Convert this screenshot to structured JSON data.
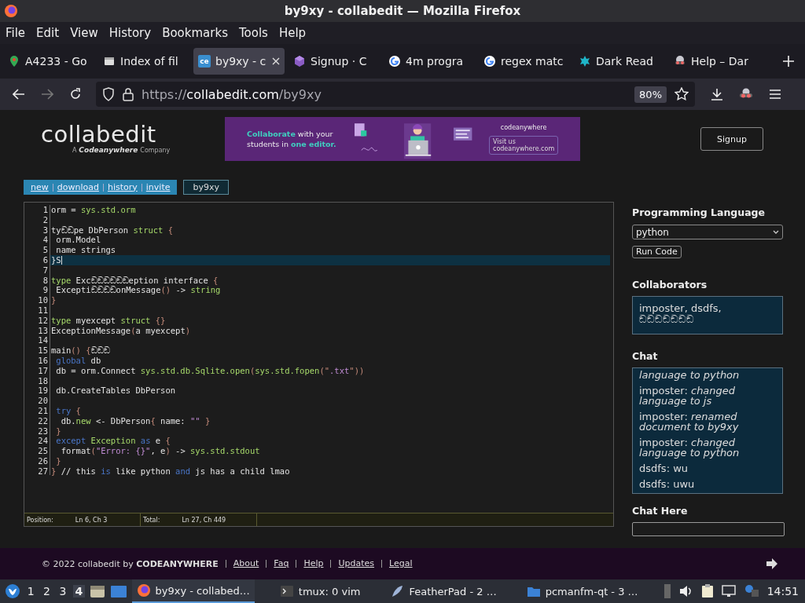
{
  "window": {
    "title": "by9xy - collabedit — Mozilla Firefox"
  },
  "menu": [
    "File",
    "Edit",
    "View",
    "History",
    "Bookmarks",
    "Tools",
    "Help"
  ],
  "tabs": [
    {
      "label": "A4233 - Go",
      "selected": false
    },
    {
      "label": "Index of fil",
      "selected": false
    },
    {
      "label": "by9xy - c",
      "icon_text": "ce",
      "selected": true
    },
    {
      "label": "Signup · C",
      "selected": false
    },
    {
      "label": "4m progra",
      "selected": false
    },
    {
      "label": "regex matc",
      "selected": false
    },
    {
      "label": "Dark Read",
      "selected": false
    },
    {
      "label": "Help – Dar",
      "selected": false
    }
  ],
  "address": {
    "prefix": "https://",
    "host": "collabedit.com",
    "path": "/by9xy",
    "zoom": "80%"
  },
  "site": {
    "logo": "collabedit",
    "logo_sub_prefix": "A",
    "logo_sub_brand": "Codeanywhere",
    "logo_sub_suffix": "Company",
    "ad": {
      "line1_accent": "Collaborate",
      "line1": "with your",
      "line2": "students in",
      "line2_accent": "one editor.",
      "brand": "codeanywhere",
      "visit": "Visit us",
      "url": "codeanywhere.com"
    },
    "signup": "Signup",
    "links": [
      "new",
      "download",
      "history",
      "invite"
    ],
    "document_name": "by9xy"
  },
  "editor": {
    "lines": [
      {
        "n": "1",
        "current": false,
        "tokens": [
          {
            "text": "orm = ",
            "kind": "plain"
          },
          {
            "text": "sys.std.orm",
            "kind": "builtin"
          }
        ]
      },
      {
        "n": "2",
        "current": false
      },
      {
        "n": "3",
        "current": false,
        "tokens": [
          {
            "text": "tyඞඞpe DbPerson ",
            "kind": "plain"
          },
          {
            "text": "struct",
            "kind": "builtin"
          },
          {
            "text": " {",
            "kind": "bracket"
          }
        ]
      },
      {
        "n": "4",
        "current": false,
        "tokens": [
          {
            "text": " orm.Model",
            "kind": "plain"
          }
        ]
      },
      {
        "n": "5",
        "current": false,
        "tokens": [
          {
            "text": " name strings",
            "kind": "plain"
          }
        ]
      },
      {
        "n": "6",
        "current": true,
        "tokens": [
          {
            "text": "}S",
            "kind": "plain"
          }
        ]
      },
      {
        "n": "7",
        "current": false
      },
      {
        "n": "8",
        "current": false,
        "tokens": [
          {
            "text": "type",
            "kind": "builtin"
          },
          {
            "text": " Excඞඞඞඞඞඞeption interface ",
            "kind": "plain"
          },
          {
            "text": "{",
            "kind": "bracket"
          }
        ]
      },
      {
        "n": "9",
        "current": false,
        "tokens": [
          {
            "text": " ExceptiඞඞඞඞonMessage",
            "kind": "plain"
          },
          {
            "text": "()",
            "kind": "bracket"
          },
          {
            "text": " -> ",
            "kind": "plain"
          },
          {
            "text": "string",
            "kind": "builtin"
          }
        ]
      },
      {
        "n": "10",
        "current": false,
        "tokens": [
          {
            "text": "}",
            "kind": "bracket"
          }
        ]
      },
      {
        "n": "11",
        "current": false
      },
      {
        "n": "12",
        "current": false,
        "tokens": [
          {
            "text": "type",
            "kind": "builtin"
          },
          {
            "text": " myexcept ",
            "kind": "plain"
          },
          {
            "text": "struct",
            "kind": "builtin"
          },
          {
            "text": " {}",
            "kind": "bracket"
          }
        ]
      },
      {
        "n": "13",
        "current": false,
        "tokens": [
          {
            "text": "ExceptionMessage",
            "kind": "plain"
          },
          {
            "text": "(",
            "kind": "bracket"
          },
          {
            "text": "a myexcept",
            "kind": "plain"
          },
          {
            "text": ")",
            "kind": "bracket"
          }
        ]
      },
      {
        "n": "14",
        "current": false
      },
      {
        "n": "15",
        "current": false,
        "tokens": [
          {
            "text": "main",
            "kind": "plain"
          },
          {
            "text": "() {",
            "kind": "bracket"
          },
          {
            "text": "ඞඞඞ",
            "kind": "plain"
          }
        ]
      },
      {
        "n": "16",
        "current": false,
        "tokens": [
          {
            "text": " global",
            "kind": "keyword"
          },
          {
            "text": " db",
            "kind": "plain"
          }
        ]
      },
      {
        "n": "17",
        "current": false,
        "tokens": [
          {
            "text": " db = orm.Connect ",
            "kind": "plain"
          },
          {
            "text": "sys.std.db.Sqlite.open",
            "kind": "builtin"
          },
          {
            "text": "(",
            "kind": "bracket"
          },
          {
            "text": "sys.std.fopen",
            "kind": "builtin"
          },
          {
            "text": "(\"",
            "kind": "bracket"
          },
          {
            "text": ".txt",
            "kind": "string"
          },
          {
            "text": "\"))",
            "kind": "bracket"
          }
        ]
      },
      {
        "n": "18",
        "current": false
      },
      {
        "n": "19",
        "current": false,
        "tokens": [
          {
            "text": " db.CreateTables DbPerson",
            "kind": "plain"
          }
        ]
      },
      {
        "n": "20",
        "current": false
      },
      {
        "n": "21",
        "current": false,
        "tokens": [
          {
            "text": " try",
            "kind": "keyword"
          },
          {
            "text": " {",
            "kind": "bracket"
          }
        ]
      },
      {
        "n": "22",
        "current": false,
        "tokens": [
          {
            "text": "  db.",
            "kind": "plain"
          },
          {
            "text": "new",
            "kind": "builtin"
          },
          {
            "text": " <- DbPerson",
            "kind": "plain"
          },
          {
            "text": "{",
            "kind": "bracket"
          },
          {
            "text": " name: ",
            "kind": "plain"
          },
          {
            "text": "\"\"",
            "kind": "string"
          },
          {
            "text": " }",
            "kind": "bracket"
          }
        ]
      },
      {
        "n": "23",
        "current": false,
        "tokens": [
          {
            "text": " }",
            "kind": "bracket"
          }
        ]
      },
      {
        "n": "24",
        "current": false,
        "tokens": [
          {
            "text": " except",
            "kind": "keyword"
          },
          {
            "text": " Exception",
            "kind": "builtin"
          },
          {
            "text": " as",
            "kind": "keyword"
          },
          {
            "text": " e ",
            "kind": "plain"
          },
          {
            "text": "{",
            "kind": "bracket"
          }
        ]
      },
      {
        "n": "25",
        "current": false,
        "tokens": [
          {
            "text": "  format",
            "kind": "plain"
          },
          {
            "text": "(",
            "kind": "bracket"
          },
          {
            "text": "\"Error: {}\"",
            "kind": "string"
          },
          {
            "text": ", e",
            "kind": "plain"
          },
          {
            "text": ")",
            "kind": "bracket"
          },
          {
            "text": " -> ",
            "kind": "plain"
          },
          {
            "text": "sys.std.stdout",
            "kind": "builtin"
          }
        ]
      },
      {
        "n": "26",
        "current": false,
        "tokens": [
          {
            "text": " }",
            "kind": "bracket"
          }
        ]
      },
      {
        "n": "27",
        "current": false,
        "tokens": [
          {
            "text": "}",
            "kind": "bracket"
          },
          {
            "text": " // this ",
            "kind": "plain"
          },
          {
            "text": "is",
            "kind": "keyword"
          },
          {
            "text": " like python ",
            "kind": "plain"
          },
          {
            "text": "and",
            "kind": "keyword"
          },
          {
            "text": " js has a child lmao",
            "kind": "plain"
          }
        ]
      }
    ],
    "status": [
      {
        "label": "Position:",
        "value": "Ln 6, Ch 3"
      },
      {
        "label": "Total:",
        "value": "Ln 27, Ch 449"
      }
    ]
  },
  "sidebar": {
    "language_heading": "Programming Language",
    "language": "python",
    "run": "Run Code",
    "collaborators_heading": "Collaborators",
    "collaborators": "imposter, dsdfs, ඞඞඞඞඞඞඞ",
    "chat_heading": "Chat",
    "chat": [
      {
        "kind": "event",
        "text": "language to python"
      },
      {
        "kind": "event",
        "user": "imposter:",
        "text": "changed language to js"
      },
      {
        "kind": "event",
        "user": "imposter:",
        "text": "renamed document to by9xy"
      },
      {
        "kind": "event",
        "user": "imposter:",
        "text": "changed language to python"
      },
      {
        "kind": "message",
        "user": "dsdfs:",
        "text": "wu"
      },
      {
        "kind": "message",
        "user": "dsdfs:",
        "text": "uwu"
      }
    ],
    "chat_input_heading": "Chat Here"
  },
  "footer": {
    "copyright": "© 2022 collabedit by",
    "brand": "CODEANYWHERE",
    "links": [
      "About",
      "Faq",
      "Help",
      "Updates",
      "Legal"
    ]
  },
  "taskbar": {
    "workspaces": [
      {
        "label": "1",
        "selected": false
      },
      {
        "label": "2",
        "selected": false
      },
      {
        "label": "3",
        "selected": false
      },
      {
        "label": "4",
        "selected": true
      }
    ],
    "tasks": [
      {
        "label": "by9xy - collabed…",
        "selected": true
      },
      {
        "label": "tmux: 0 vim",
        "selected": false
      },
      {
        "label": "FeatherPad - 2 …",
        "selected": false
      },
      {
        "label": "pcmanfm-qt - 3 …",
        "selected": false
      }
    ],
    "clock": "14:51"
  }
}
